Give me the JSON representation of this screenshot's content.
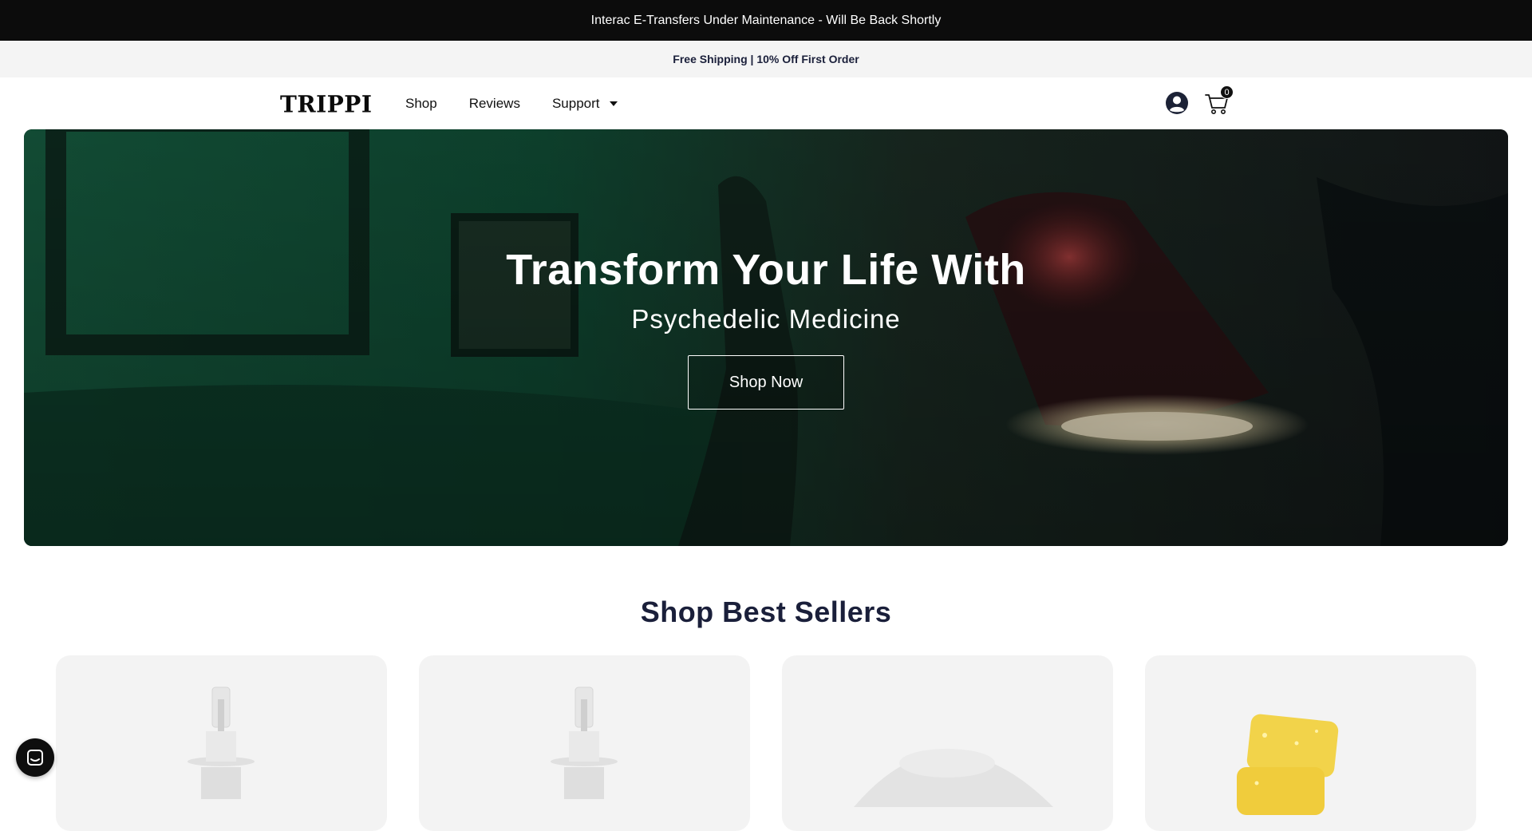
{
  "announcement": {
    "top": "Interac E-Transfers Under Maintenance - Will Be Back Shortly",
    "sub": "Free Shipping | 10% Off First Order"
  },
  "header": {
    "logo": "TRIPPI",
    "nav": [
      {
        "label": "Shop"
      },
      {
        "label": "Reviews"
      },
      {
        "label": "Support"
      }
    ],
    "cart_count": "0"
  },
  "hero": {
    "title": "Transform Your Life With",
    "subtitle": "Psychedelic Medicine",
    "button": "Shop Now"
  },
  "best_sellers": {
    "title": "Shop Best Sellers",
    "products": [
      {
        "image": "nasal-spray-bottle"
      },
      {
        "image": "nasal-spray-bottle"
      },
      {
        "image": "white-powder"
      },
      {
        "image": "yellow-gummies"
      }
    ]
  },
  "icons": {
    "account": "account-circle-icon",
    "cart": "shopping-cart-icon",
    "chat": "chat-launcher-icon"
  },
  "colors": {
    "announcement_bg": "#0c0c0c",
    "heading": "#1a1f3a",
    "card_bg": "#f3f3f3"
  }
}
